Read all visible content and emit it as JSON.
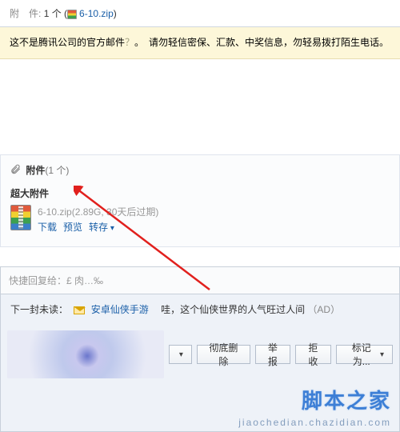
{
  "top_attach": {
    "label": "附　件:",
    "count": "1 个",
    "filename": "6-10.zip"
  },
  "warning": {
    "part1": "这不是腾讯公司的官方邮件",
    "qmark": "？",
    "part2": "。　请勿轻信密保、汇款、中奖信息，勿轻易拨打陌生电话。"
  },
  "attach_section": {
    "title": "附件",
    "count": "(1 个)",
    "subtitle": "超大附件",
    "file": {
      "name": "6-10.zip",
      "meta": "(2.89G, 30天后过期)",
      "download": "下载",
      "preview": "预览",
      "forward": "转存"
    }
  },
  "quick_reply": {
    "label": "快捷回复给：",
    "placeholder_rest": "£ 肉…‰"
  },
  "next_unread": {
    "prefix": "下一封未读：",
    "subject": "安卓仙侠手游",
    "desc": "　哇，这个仙侠世界的人气旺过人间",
    "ad": "（AD）"
  },
  "buttons": {
    "b1": "",
    "delete_full": "彻底删除",
    "report": "举报",
    "reject": "拒收",
    "mark_as": "标记为..."
  },
  "watermark": {
    "big": "脚本之家",
    "small": "jiaochedian.chazidian.com"
  }
}
